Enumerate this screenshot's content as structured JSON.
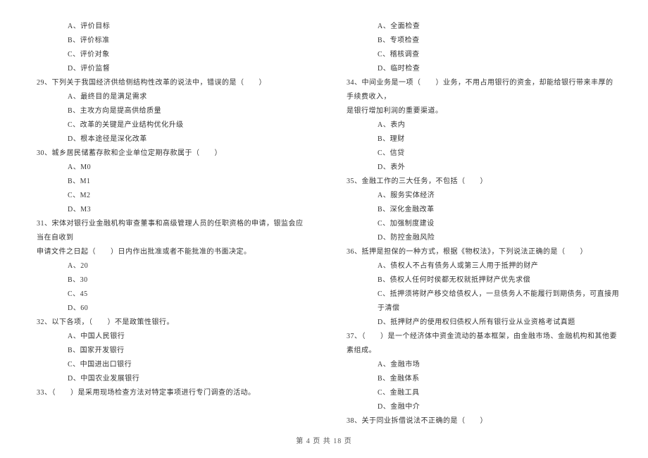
{
  "left": {
    "pre_options": [
      "A、评价目标",
      "B、评价标准",
      "C、评价对象",
      "D、评价监督"
    ],
    "q29": {
      "stem": "29、下列关于我国经济供给侧结构性改革的说法中，错误的是（　　）",
      "options": [
        "A、最终目的是满足需求",
        "B、主攻方向是提高供给质量",
        "C、改革的关键是产业结构优化升级",
        "D、根本途径是深化改革"
      ]
    },
    "q30": {
      "stem": "30、城乡居民储蓄存款和企业单位定期存款属于（　　）",
      "options": [
        "A、M0",
        "B、M1",
        "C、M2",
        "D、M3"
      ]
    },
    "q31": {
      "stem": "31、宋体对银行业金融机构审查董事和高级管理人员的任职资格的申请，银监会应当在自收到",
      "stem2": "申请文件之日起（　　）日内作出批准或者不能批准的书面决定。",
      "options": [
        "A、20",
        "B、30",
        "C、45",
        "D、60"
      ]
    },
    "q32": {
      "stem": "32、以下各项，（　　）不是政策性银行。",
      "options": [
        "A、中国人民银行",
        "B、国家开发银行",
        "C、中国进出口银行",
        "D、中国农业发展银行"
      ]
    },
    "q33": {
      "stem": "33、（　　）是采用现场检查方法对特定事项进行专门调查的活动。"
    }
  },
  "right": {
    "pre_options": [
      "A、全面检查",
      "B、专项检查",
      "C、稽核调查",
      "D、临时检查"
    ],
    "q34": {
      "stem": "34、中间业务是一项（　　）业务，不用占用银行的资金，却能给银行带来丰厚的手续费收入，",
      "stem2": "是银行增加利润的重要渠道。",
      "options": [
        "A、表内",
        "B、理财",
        "C、信贷",
        "D、表外"
      ]
    },
    "q35": {
      "stem": "35、金融工作的三大任务，不包括（　　）",
      "options": [
        "A、服务实体经济",
        "B、深化金融改革",
        "C、加强制度建设",
        "D、防控金融风险"
      ]
    },
    "q36": {
      "stem": "36、抵押是担保的一种方式，根据《物权法》，下列说法正确的是（　　）",
      "options": [
        "A、债权人不占有债务人或第三人用于抵押的财产",
        "B、债权人任何时侯都无权就抵押财产优先求偿",
        "C、抵押须将财产移交给债权人，一旦债务人不能履行到期债务，可直接用于清偿",
        "D、抵押财产的使用权归债权人所有银行业从业资格考试真题"
      ]
    },
    "q37": {
      "stem": "37、（　　）是一个经济体中资金流动的基本框架，由金融市场、金融机构和其他要素组成。",
      "options": [
        "A、金融市场",
        "B、金融体系",
        "C、金融工具",
        "D、金融中介"
      ]
    },
    "q38": {
      "stem": "38、关于同业拆借说法不正确的是（　　）"
    }
  },
  "footer": "第 4 页 共 18 页"
}
